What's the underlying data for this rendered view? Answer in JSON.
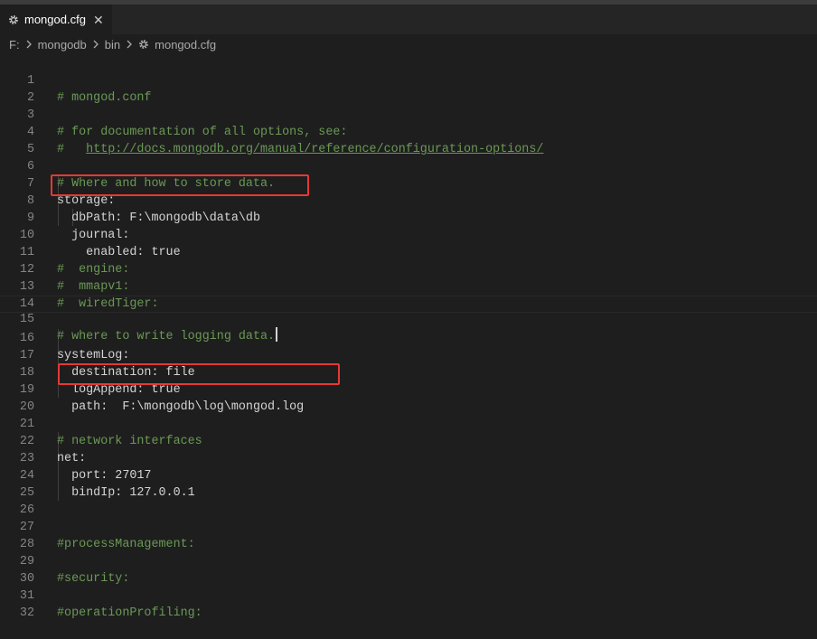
{
  "tab": {
    "label": "mongod.cfg",
    "close_glyph": "✕",
    "icon": "gear-icon"
  },
  "breadcrumb": {
    "drive": "F:",
    "folder1": "mongodb",
    "folder2": "bin",
    "file": "mongod.cfg"
  },
  "lines": [
    {
      "num": "1",
      "comment": "# mongod.conf"
    },
    {
      "num": "2"
    },
    {
      "num": "3",
      "comment": "# for documentation of all options, see:"
    },
    {
      "num": "4",
      "comment": "#   ",
      "link": "http://docs.mongodb.org/manual/reference/configuration-options/"
    },
    {
      "num": "5"
    },
    {
      "num": "6",
      "comment": "# Where and how to store data."
    },
    {
      "num": "7",
      "key": "storage:"
    },
    {
      "num": "8",
      "key": "  dbPath:",
      "value": " F:\\mongodb\\data\\db"
    },
    {
      "num": "9",
      "key": "  journal:"
    },
    {
      "num": "10",
      "key": "    enabled:",
      "value": " true"
    },
    {
      "num": "11",
      "comment": "#  engine:"
    },
    {
      "num": "12",
      "comment": "#  mmapv1:"
    },
    {
      "num": "13",
      "comment": "#  wiredTiger:"
    },
    {
      "num": "14"
    },
    {
      "num": "15",
      "comment": "# where to write logging data.",
      "current": true
    },
    {
      "num": "16",
      "key": "systemLog:"
    },
    {
      "num": "17",
      "key": "  destination:",
      "value": " file"
    },
    {
      "num": "18",
      "key": "  logAppend:",
      "value": " true"
    },
    {
      "num": "19",
      "key": "  path:",
      "value": "  F:\\mongodb\\log\\mongod.log"
    },
    {
      "num": "20"
    },
    {
      "num": "21",
      "comment": "# network interfaces"
    },
    {
      "num": "22",
      "key": "net:"
    },
    {
      "num": "23",
      "key": "  port:",
      "value": " 27017"
    },
    {
      "num": "24",
      "key": "  bindIp:",
      "value": " 127.0.0.1"
    },
    {
      "num": "25"
    },
    {
      "num": "26"
    },
    {
      "num": "27",
      "comment": "#processManagement:"
    },
    {
      "num": "28"
    },
    {
      "num": "29",
      "comment": "#security:"
    },
    {
      "num": "30"
    },
    {
      "num": "31",
      "comment": "#operationProfiling:"
    },
    {
      "num": "32"
    }
  ],
  "colors": {
    "accent_box": "#e53935",
    "comment": "#6a9955",
    "text": "#d4d4d4"
  }
}
